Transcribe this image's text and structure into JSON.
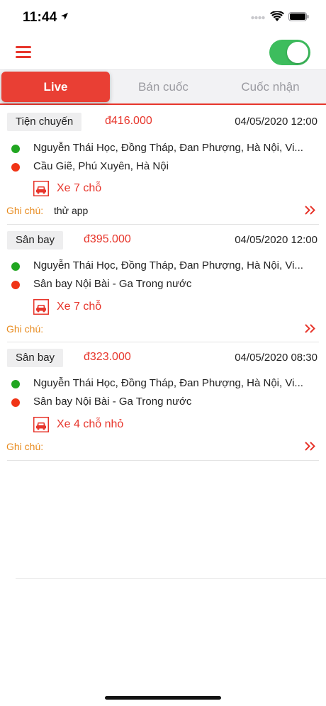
{
  "status_bar": {
    "time": "11:44"
  },
  "header": {
    "toggle_on": true,
    "accent_color": "#e7352b",
    "toggle_color": "#3dbd5d"
  },
  "tabs": [
    {
      "label": "Live",
      "active": true
    },
    {
      "label": "Bán cuốc",
      "active": false
    },
    {
      "label": "Cuốc nhận",
      "active": false
    }
  ],
  "trips": [
    {
      "type": "Tiện chuyến",
      "price": "đ416.000",
      "datetime": "04/05/2020 12:00",
      "pickup": "Nguyễn Thái Học, Đồng Tháp, Đan Phượng, Hà Nội, Vi...",
      "dropoff": "Cầu Giẽ, Phú Xuyên, Hà Nội",
      "vehicle": "Xe 7 chỗ",
      "note_label": "Ghi chú:",
      "note": "thử app"
    },
    {
      "type": "Sân bay",
      "price": "đ395.000",
      "datetime": "04/05/2020 12:00",
      "pickup": "Nguyễn Thái Học, Đồng Tháp, Đan Phượng, Hà Nội, Vi...",
      "dropoff": "Sân bay Nội Bài - Ga Trong nước",
      "vehicle": "Xe 7 chỗ",
      "note_label": "Ghi chú:",
      "note": ""
    },
    {
      "type": "Sân bay",
      "price": "đ323.000",
      "datetime": "04/05/2020 08:30",
      "pickup": "Nguyễn Thái Học, Đồng Tháp, Đan Phượng, Hà Nội, Vi...",
      "dropoff": "Sân bay Nội Bài - Ga Trong nước",
      "vehicle": "Xe 4 chỗ nhỏ",
      "note_label": "Ghi chú:",
      "note": ""
    }
  ],
  "icons": {
    "location_arrow": "location-arrow-icon",
    "wifi": "wifi-icon",
    "battery": "battery-icon",
    "menu": "hamburger-menu-icon",
    "car": "car-icon",
    "more": "double-chevron-right-icon"
  }
}
